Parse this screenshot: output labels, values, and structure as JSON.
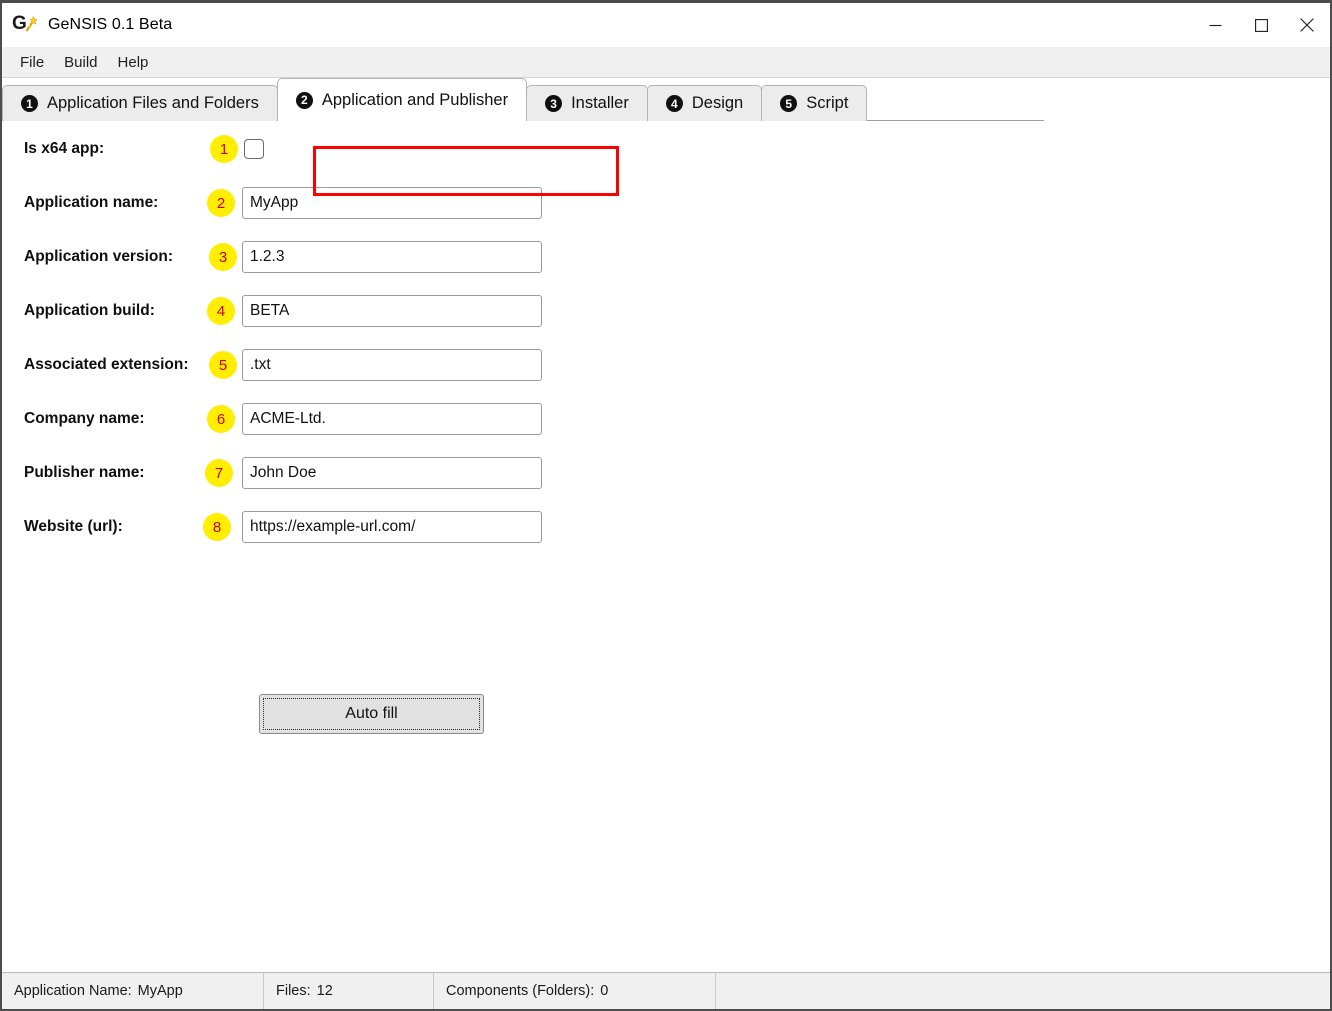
{
  "window": {
    "title": "GeNSIS 0.1 Beta",
    "icon": "gensis-wand-icon",
    "controls": [
      {
        "name": "minimize-button",
        "glyph": "minimize-icon"
      },
      {
        "name": "maximize-button",
        "glyph": "maximize-icon"
      },
      {
        "name": "close-button",
        "glyph": "close-icon"
      }
    ]
  },
  "menu": {
    "items": [
      {
        "label": "File"
      },
      {
        "label": "Build"
      },
      {
        "label": "Help"
      }
    ]
  },
  "tabs": {
    "active_index": 1,
    "items": [
      {
        "number": "1",
        "label": "Application Files and Folders"
      },
      {
        "number": "2",
        "label": "Application and Publisher"
      },
      {
        "number": "3",
        "label": "Installer"
      },
      {
        "number": "4",
        "label": "Design"
      },
      {
        "number": "5",
        "label": "Script"
      }
    ],
    "highlight_color": "#ff0000"
  },
  "form": {
    "badge_colors": {
      "background": "#ffee00",
      "text": "#cc0000"
    },
    "rows": [
      {
        "badge": "1",
        "label": "Is x64 app:",
        "control": "checkbox",
        "checked": false,
        "value": "",
        "placeholder": ""
      },
      {
        "badge": "2",
        "label": "Application name:",
        "control": "text",
        "value": "MyApp",
        "placeholder": "Application name"
      },
      {
        "badge": "3",
        "label": "Application version:",
        "control": "text",
        "value": "1.2.3",
        "placeholder": "Application version"
      },
      {
        "badge": "4",
        "label": "Application build:",
        "control": "text",
        "value": "BETA",
        "placeholder": "Application build"
      },
      {
        "badge": "5",
        "label": "Associated extension:",
        "control": "text",
        "value": ".txt",
        "placeholder": "Associated extension"
      },
      {
        "badge": "6",
        "label": "Company name:",
        "control": "text",
        "value": "ACME-Ltd.",
        "placeholder": "Company name"
      },
      {
        "badge": "7",
        "label": "Publisher name:",
        "control": "text",
        "value": "John Doe",
        "placeholder": "Publisher name"
      },
      {
        "badge": "8",
        "label": "Website (url):",
        "control": "text",
        "value": "https://example-url.com/",
        "placeholder": "Website (url)"
      }
    ],
    "autofill_label": "Auto fill"
  },
  "status_bar": {
    "cells": [
      {
        "label": "Application Name:",
        "value": "MyApp"
      },
      {
        "label": "Files:",
        "value": "12"
      },
      {
        "label": "Components (Folders):",
        "value": "0"
      },
      {
        "label": "",
        "value": ""
      }
    ]
  }
}
